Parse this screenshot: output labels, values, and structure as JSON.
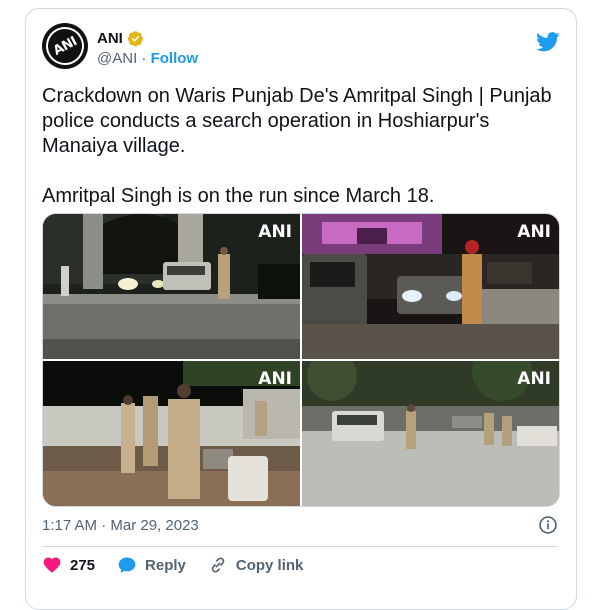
{
  "author": {
    "name": "ANI",
    "handle": "@ANI",
    "separator": "·",
    "follow_label": "Follow",
    "avatar_text": "ANI"
  },
  "tweet": {
    "text": "Crackdown on Waris Punjab De's Amritpal Singh | Punjab police conducts a search operation in Hoshiarpur's Manaiya village.\n\nAmritpal Singh is on the run since March 18.",
    "timestamp": "1:17 AM · Mar 29, 2023"
  },
  "media": {
    "watermark": "ANI"
  },
  "actions": {
    "like_count": "275",
    "reply_label": "Reply",
    "copy_link_label": "Copy link"
  },
  "colors": {
    "accent": "#1d9bf0",
    "like": "#f91880",
    "verified": "#e2b719",
    "muted": "#536471"
  },
  "icons": {
    "bird": "twitter-bird-icon",
    "verified": "verified-badge-icon",
    "info": "info-icon",
    "heart": "heart-icon",
    "reply": "reply-bubble-icon",
    "link": "link-icon"
  }
}
